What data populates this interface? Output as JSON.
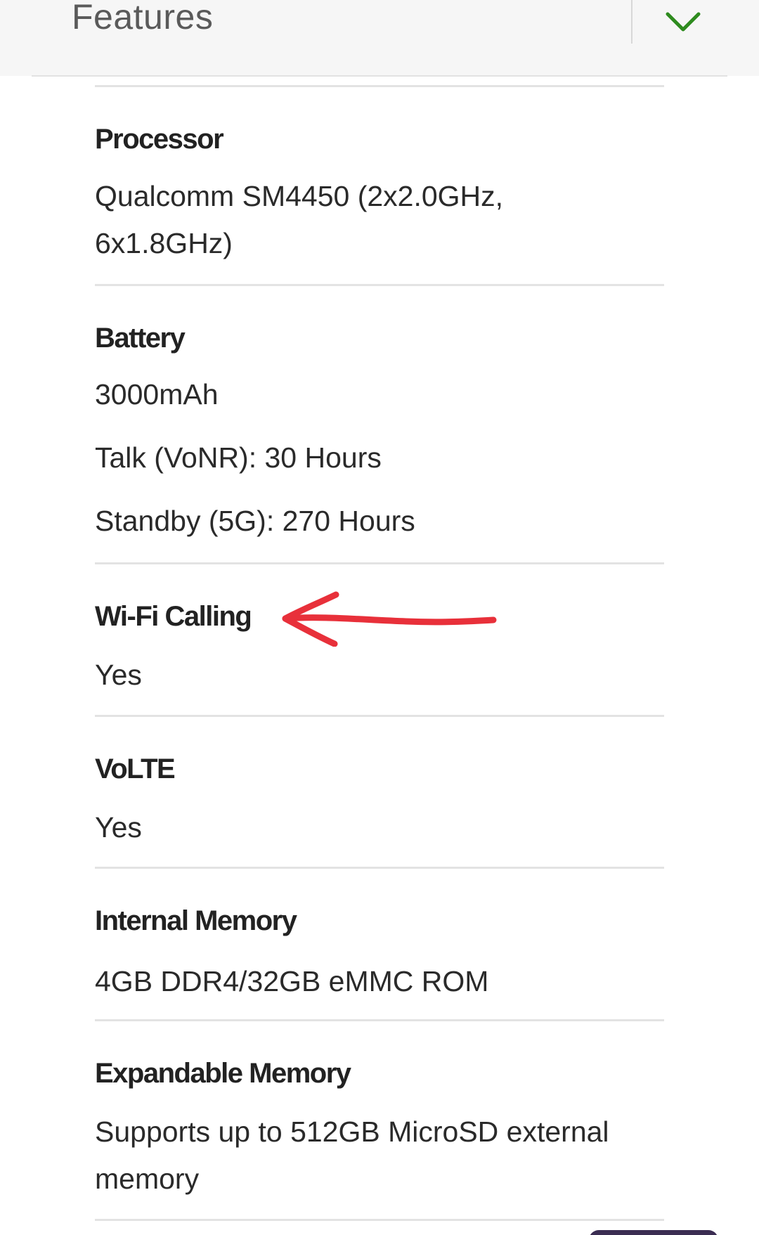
{
  "accordion": {
    "title": "Features",
    "toggle_icon": "chevron-down-icon",
    "accent_color": "#2e8b1e"
  },
  "specs": {
    "processor": {
      "label": "Processor",
      "lines": [
        "Qualcomm SM4450 (2x2.0GHz,",
        "6x1.8GHz)"
      ]
    },
    "battery": {
      "label": "Battery",
      "lines": [
        "3000mAh",
        "Talk (VoNR): 30 Hours",
        "Standby (5G): 270 Hours"
      ]
    },
    "wifi_calling": {
      "label": "Wi-Fi Calling",
      "value": "Yes"
    },
    "volte": {
      "label": "VoLTE",
      "value": "Yes"
    },
    "internal_memory": {
      "label": "Internal Memory",
      "value": "4GB DDR4/32GB eMMC ROM"
    },
    "expandable_memory": {
      "label": "Expandable Memory",
      "lines": [
        "Supports up to 512GB MicroSD external",
        "memory"
      ]
    }
  },
  "annotation": {
    "icon": "arrow-left-icon",
    "color": "#e8303a"
  }
}
